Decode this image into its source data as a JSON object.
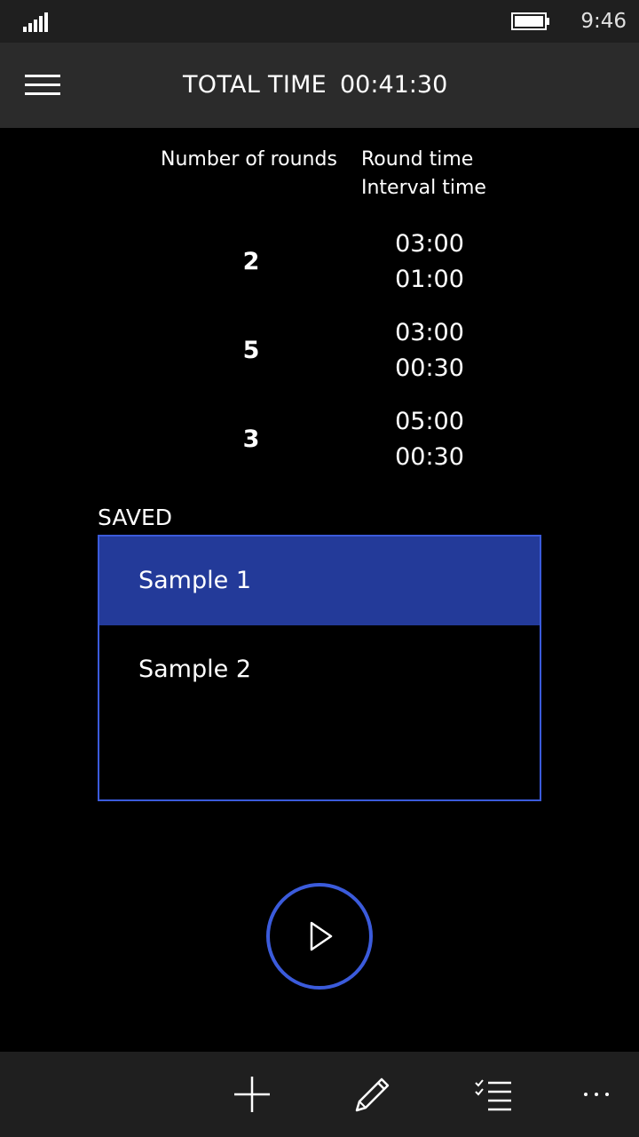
{
  "status_bar": {
    "time": "9:46",
    "icons": [
      "signal-icon",
      "battery-icon"
    ]
  },
  "header": {
    "menu_icon": "hamburger-menu-icon",
    "total_label": "TOTAL TIME",
    "total_value": "00:41:30"
  },
  "rounds_table": {
    "col_rounds": "Number of rounds",
    "col_round_time": "Round time",
    "col_interval_time": "Interval time",
    "rows": [
      {
        "rounds": "2",
        "round_time": "03:00",
        "interval_time": "01:00"
      },
      {
        "rounds": "5",
        "round_time": "03:00",
        "interval_time": "00:30"
      },
      {
        "rounds": "3",
        "round_time": "05:00",
        "interval_time": "00:30"
      }
    ]
  },
  "saved": {
    "label": "SAVED",
    "items": [
      {
        "name": "Sample 1",
        "selected": true
      },
      {
        "name": "Sample 2",
        "selected": false
      }
    ]
  },
  "play_button": {
    "icon": "play-icon"
  },
  "app_bar": {
    "buttons": [
      "add-icon",
      "edit-pencil-icon",
      "checklist-icon",
      "more-ellipsis-icon"
    ]
  },
  "colors": {
    "accent": "#3b5bdb",
    "selected_bg": "#233a99",
    "header_bg": "#2b2b2b",
    "bar_bg": "#1f1f1f",
    "background": "#000000"
  }
}
